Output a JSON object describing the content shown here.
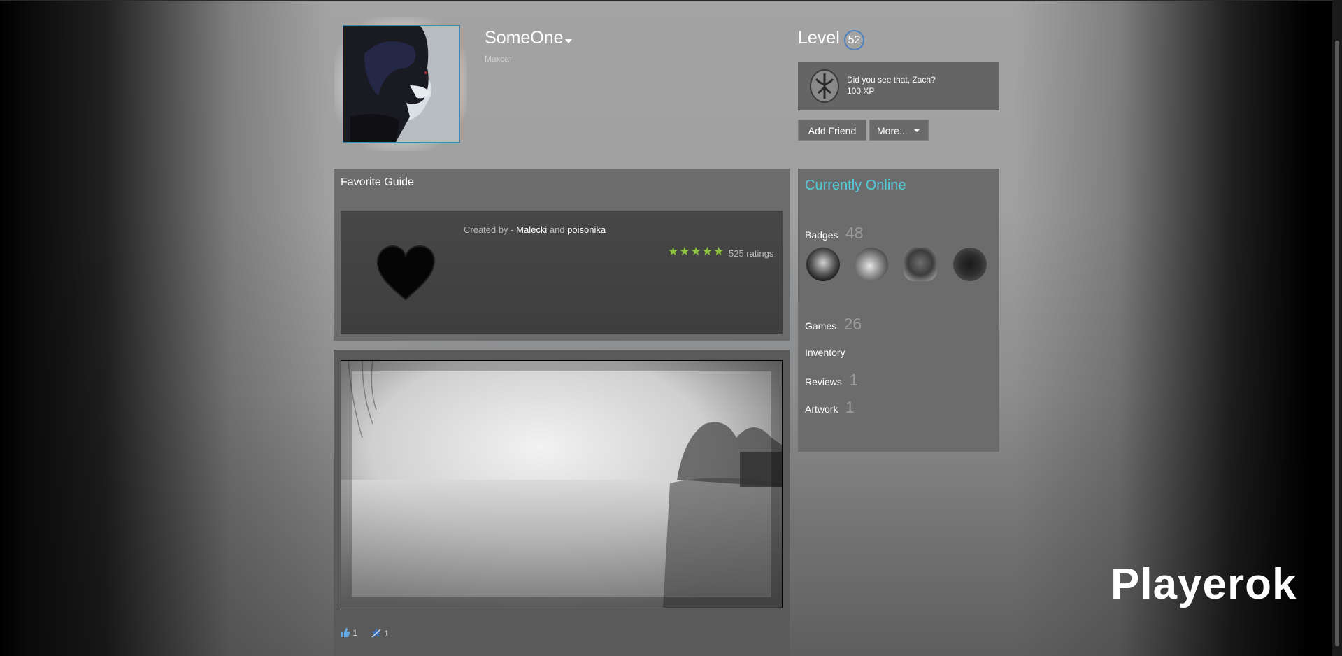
{
  "profile": {
    "persona_name": "SomeOne",
    "real_name": "Максат",
    "level_label": "Level",
    "level": "52"
  },
  "featured_badge": {
    "title": "Did you see that, Zach?",
    "xp": "100 XP",
    "icon": "badge-rune-icon"
  },
  "actions": {
    "add_friend": "Add Friend",
    "more": "More..."
  },
  "favorite_guide": {
    "heading": "Favorite Guide",
    "created_by_prefix": "Created by - ",
    "author_1": "Malecki",
    "and": " and ",
    "author_2": "poisonika",
    "stars": "★★★★★",
    "ratings": "525 ratings"
  },
  "screenshot": {
    "likes": "1",
    "awards": "1"
  },
  "sidebar": {
    "online_status": "Currently Online",
    "badges_label": "Badges",
    "badges_count": "48",
    "games_label": "Games",
    "games_count": "26",
    "inventory_label": "Inventory",
    "reviews_label": "Reviews",
    "reviews_count": "1",
    "artwork_label": "Artwork",
    "artwork_count": "1"
  },
  "watermark": "Playerok",
  "colors": {
    "online": "#57cbde",
    "stars": "#8bc53f",
    "level_ring": "#4b82c4"
  }
}
